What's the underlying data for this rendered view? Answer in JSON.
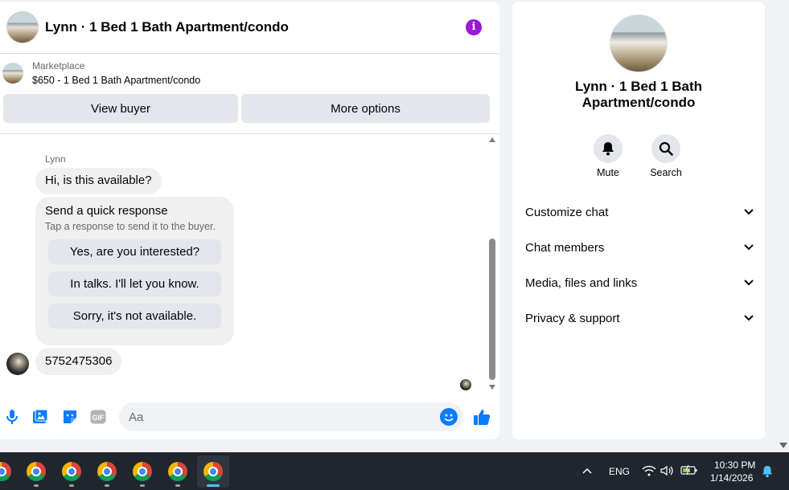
{
  "chat": {
    "title": "Lynn · 1 Bed 1 Bath Apartment/condo",
    "marketplace_label": "Marketplace",
    "listing": "$650 - 1 Bed 1 Bath Apartment/condo",
    "view_buyer": "View buyer",
    "more_options": "More options"
  },
  "messages": {
    "sender": "Lynn",
    "first_message": "Hi, is this available?",
    "quick_title": "Send a quick response",
    "quick_subtitle": "Tap a response to send it to the buyer.",
    "quick_options": [
      "Yes, are you interested?",
      "In talks. I'll let you know.",
      "Sorry, it's not available."
    ],
    "phone_message": "5752475306"
  },
  "composer": {
    "placeholder": "Aa"
  },
  "info_panel": {
    "name": "Lynn · 1 Bed 1 Bath Apartment/condo",
    "mute_label": "Mute",
    "search_label": "Search",
    "sections": [
      "Customize chat",
      "Chat members",
      "Media, files and links",
      "Privacy & support"
    ]
  },
  "taskbar": {
    "language": "ENG",
    "time": "10:30 PM",
    "date": "1/14/2026"
  },
  "colors": {
    "accent": "#0a7cff",
    "info": "#9b16d8"
  }
}
